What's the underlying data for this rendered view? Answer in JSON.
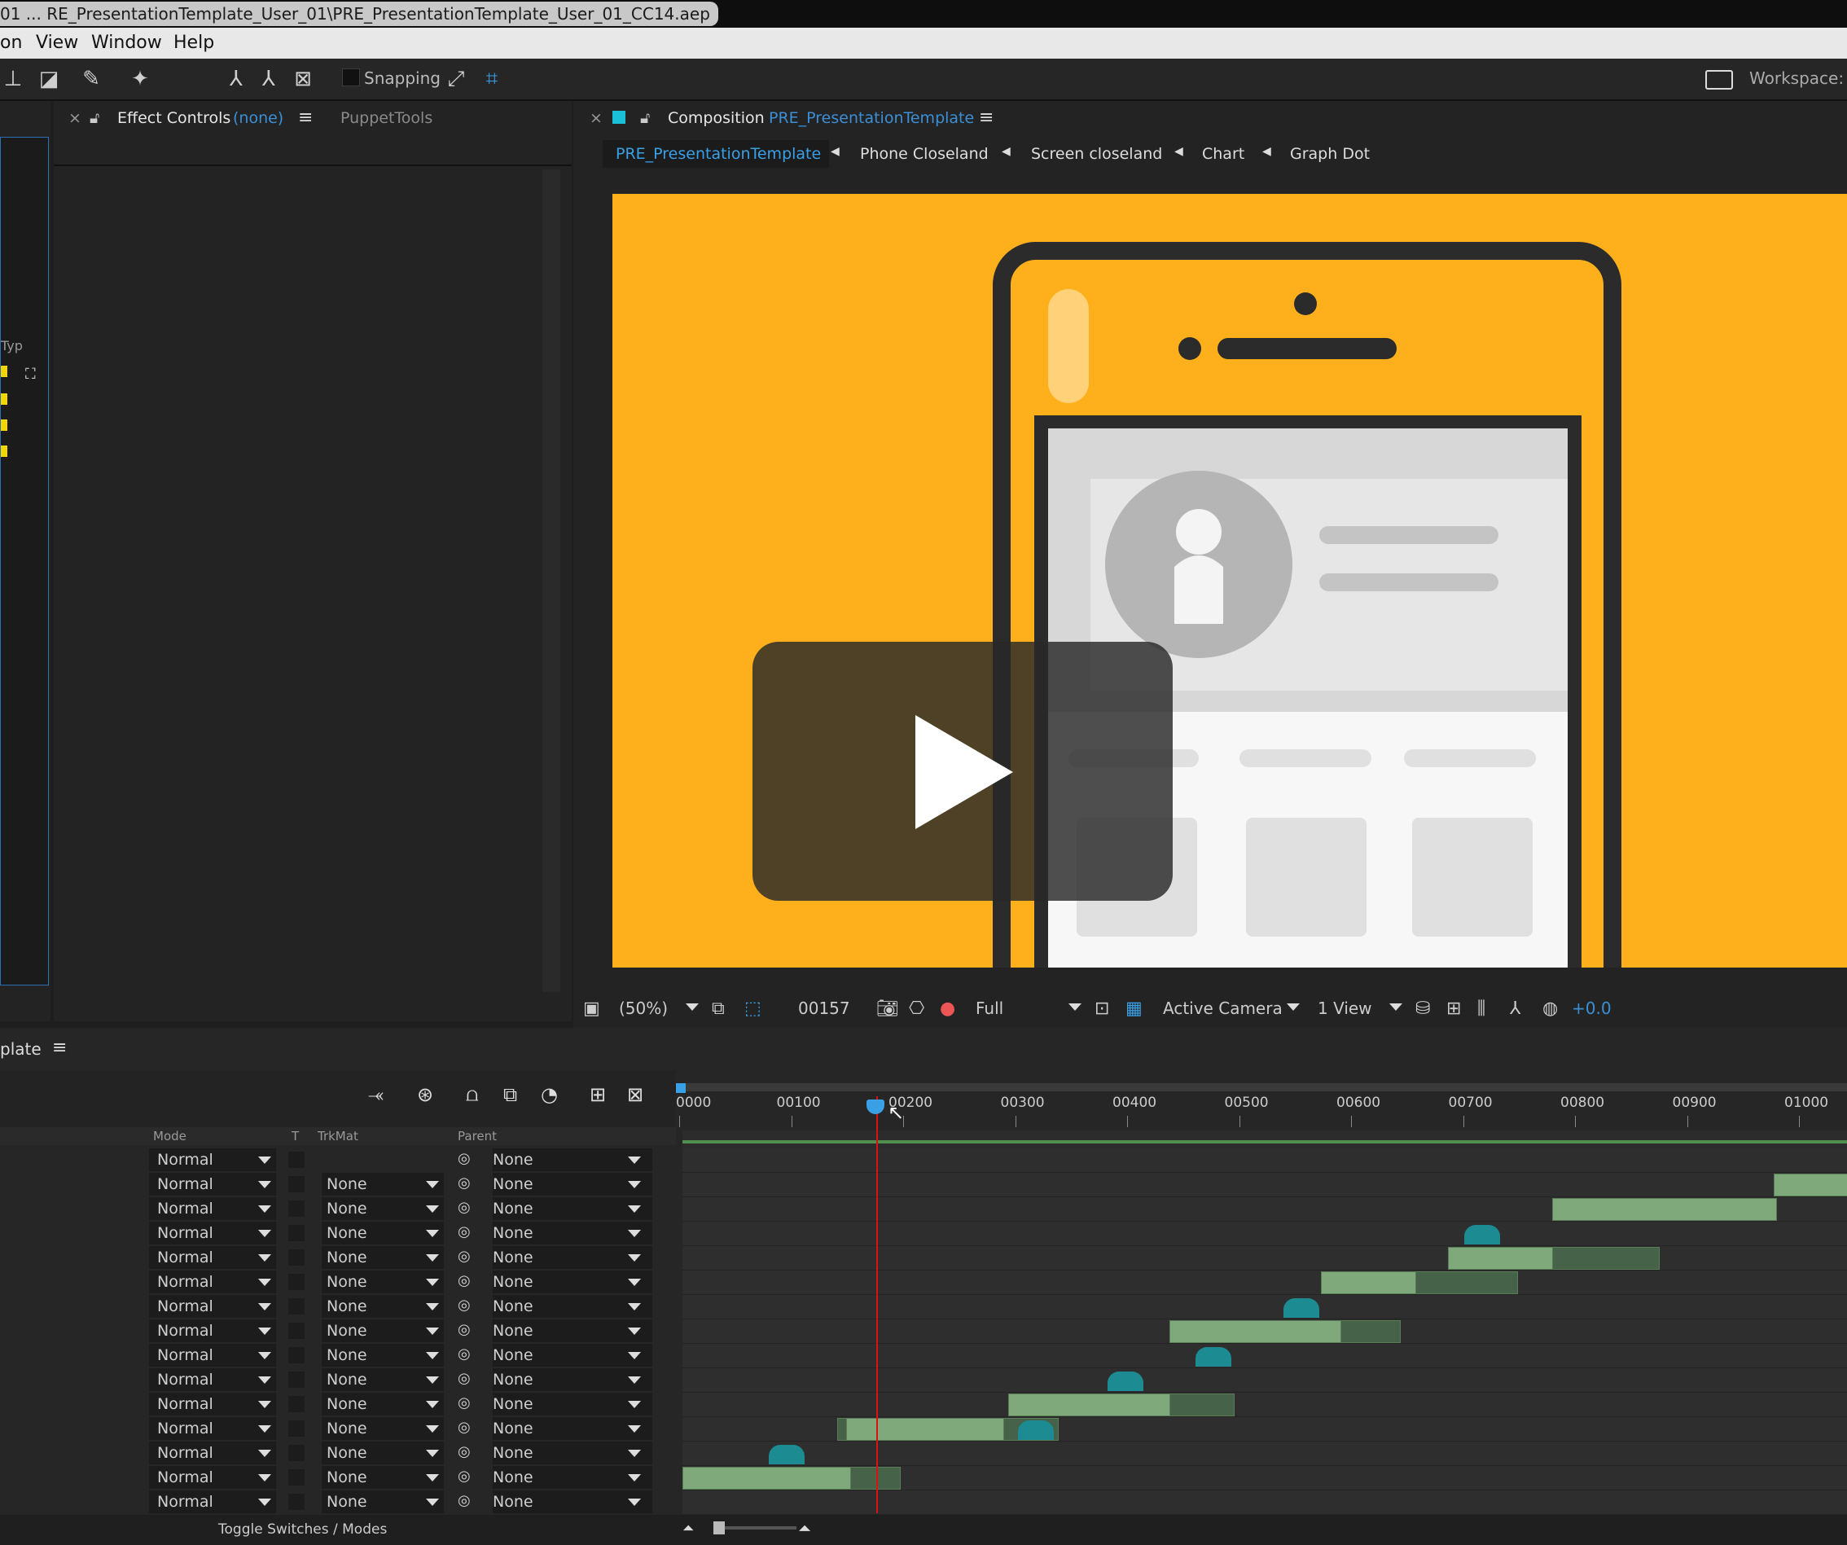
{
  "window": {
    "title": "01 ... RE_PresentationTemplate_User_01\\PRE_PresentationTemplate_User_01_CC14.aep"
  },
  "menu": {
    "items": [
      "on",
      "View",
      "Window",
      "Help"
    ]
  },
  "toolbar": {
    "snapping_label": "Snapping",
    "workspace_label": "Workspace:"
  },
  "effect_controls": {
    "title": "Effect Controls",
    "target": "(none)",
    "menu_icon": "hamburger-icon",
    "second_tab": "PuppetTools"
  },
  "left_strip": {
    "type_label": "Typ"
  },
  "composition": {
    "title": "Composition",
    "name": "PRE_PresentationTemplate",
    "breadcrumbs": [
      "PRE_PresentationTemplate",
      "Phone Closeland",
      "Screen closeland",
      "Chart",
      "Graph Dot"
    ],
    "artboard_color": "#fdb01b"
  },
  "viewer": {
    "zoom": "(50%)",
    "timecode": "00157",
    "resolution": "Full",
    "camera": "Active Camera",
    "views": "1 View",
    "exposure": "+0.0"
  },
  "timeline": {
    "tab_label": "plate",
    "columns": {
      "mode": "Mode",
      "t": "T",
      "trkmat": "TrkMat",
      "parent": "Parent"
    },
    "ruler_ticks": [
      "0000",
      "00100",
      "00200",
      "00300",
      "00400",
      "00500",
      "00600",
      "00700",
      "00800",
      "00900",
      "01000"
    ],
    "rows": [
      {
        "mode": "Normal",
        "trkmat": "",
        "parent": "None"
      },
      {
        "mode": "Normal",
        "trkmat": "None",
        "parent": "None"
      },
      {
        "mode": "Normal",
        "trkmat": "None",
        "parent": "None"
      },
      {
        "mode": "Normal",
        "trkmat": "None",
        "parent": "None"
      },
      {
        "mode": "Normal",
        "trkmat": "None",
        "parent": "None"
      },
      {
        "mode": "Normal",
        "trkmat": "None",
        "parent": "None"
      },
      {
        "mode": "Normal",
        "trkmat": "None",
        "parent": "None"
      },
      {
        "mode": "Normal",
        "trkmat": "None",
        "parent": "None"
      },
      {
        "mode": "Normal",
        "trkmat": "None",
        "parent": "None"
      },
      {
        "mode": "Normal",
        "trkmat": "None",
        "parent": "None"
      },
      {
        "mode": "Normal",
        "trkmat": "None",
        "parent": "None"
      },
      {
        "mode": "Normal",
        "trkmat": "None",
        "parent": "None"
      },
      {
        "mode": "Normal",
        "trkmat": "None",
        "parent": "None"
      },
      {
        "mode": "Normal",
        "trkmat": "None",
        "parent": "None"
      },
      {
        "mode": "Normal",
        "trkmat": "None",
        "parent": "None"
      }
    ],
    "toggle_label": "Toggle Switches / Modes"
  }
}
